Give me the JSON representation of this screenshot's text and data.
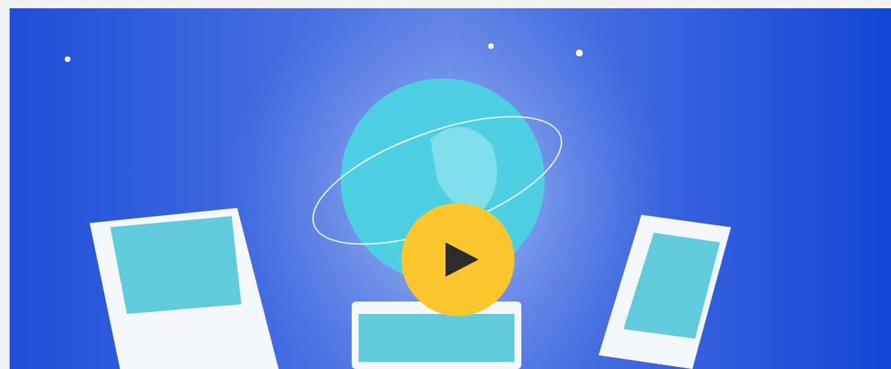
{
  "video": {
    "kind": "picture",
    "play_button": true
  }
}
